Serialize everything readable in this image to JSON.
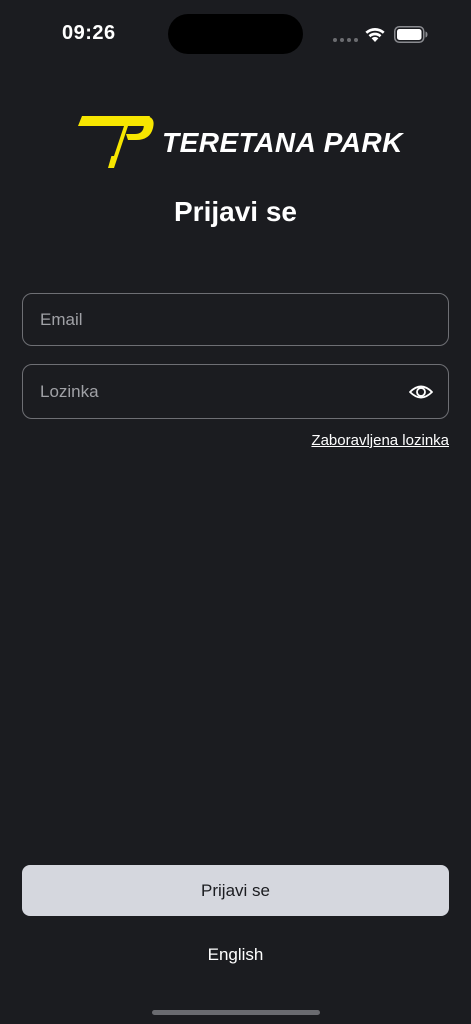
{
  "status_bar": {
    "time": "09:26"
  },
  "brand": {
    "name": "TERETANA PARK",
    "accent_color": "#f7e600"
  },
  "login": {
    "title": "Prijavi se",
    "email_placeholder": "Email",
    "email_value": "",
    "password_placeholder": "Lozinka",
    "password_value": "",
    "forgot_password_label": "Zaboravljena lozinka",
    "submit_label": "Prijavi se",
    "language_label": "English"
  },
  "icons": {
    "wifi": "wifi-icon",
    "battery": "battery-icon",
    "show_password": "eye-icon",
    "logo_mark": "logo-mark-icon"
  },
  "colors": {
    "background": "#1b1c20",
    "button": "#d5d7de",
    "field_border": "#6e6f74"
  }
}
